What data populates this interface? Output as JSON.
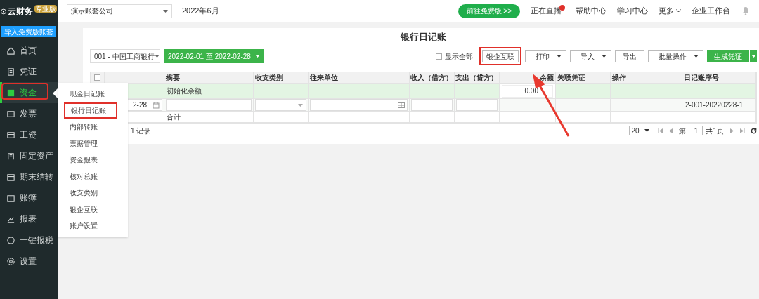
{
  "brand": {
    "name": "云财务",
    "badge": "专业版"
  },
  "import_button": "导入免费版账套",
  "sidebar": {
    "items": [
      {
        "label": "首页",
        "selected": false
      },
      {
        "label": "凭证",
        "selected": false
      },
      {
        "label": "资金",
        "selected": true
      },
      {
        "label": "发票",
        "selected": false
      },
      {
        "label": "工资",
        "selected": false
      },
      {
        "label": "固定资产",
        "selected": false
      },
      {
        "label": "期末结转",
        "selected": false
      },
      {
        "label": "账簿",
        "selected": false
      },
      {
        "label": "报表",
        "selected": false
      },
      {
        "label": "一键报税",
        "selected": false
      },
      {
        "label": "设置",
        "selected": false
      }
    ]
  },
  "submenu": {
    "items": [
      {
        "label": "现金日记账",
        "selected": false
      },
      {
        "label": "银行日记账",
        "selected": true
      },
      {
        "label": "内部转账",
        "selected": false
      },
      {
        "label": "票据管理",
        "selected": false
      },
      {
        "label": "资金报表",
        "selected": false
      },
      {
        "label": "核对总账",
        "selected": false
      },
      {
        "label": "收支类别",
        "selected": false
      },
      {
        "label": "银企互联",
        "selected": false
      },
      {
        "label": "账户设置",
        "selected": false
      }
    ]
  },
  "topbar": {
    "company": "演示账套公司",
    "period": "2022年6月",
    "promo": "前往免费版 >>",
    "links": [
      "正在直播",
      "帮助中心",
      "学习中心",
      "更多",
      "企业工作台"
    ]
  },
  "page_title": "银行日记账",
  "toolbar": {
    "account": "001 - 中国工商银行",
    "date_range": "2022-02-01 至 2022-02-28",
    "show_all": {
      "label": "显示全部",
      "checked": false
    },
    "buttons": [
      {
        "label": "银企互联",
        "kind": "plain"
      },
      {
        "label": "打印",
        "kind": "dropdown"
      },
      {
        "label": "导入",
        "kind": "dropdown"
      },
      {
        "label": "导出",
        "kind": "plain"
      },
      {
        "label": "批量操作",
        "kind": "dropdown"
      },
      {
        "label": "生成凭证",
        "kind": "primary"
      }
    ]
  },
  "table": {
    "select_all": {
      "checked": false
    },
    "columns": [
      "摘要",
      "收支类别",
      "往来单位",
      "收入（借方）",
      "支出（贷方）",
      "余额",
      "关联凭证",
      "操作",
      "日记账序号"
    ],
    "opening_row": {
      "summary": "初始化余额",
      "balance": "0.00"
    },
    "entry_row": {
      "date": "2-28",
      "serial": "2-001-20220228-1"
    },
    "total_row": {
      "summary": "合计"
    }
  },
  "pager": {
    "records": "1 记录",
    "page_size": "20",
    "page_label": "第",
    "page": "1",
    "total_pages": "共1页"
  }
}
